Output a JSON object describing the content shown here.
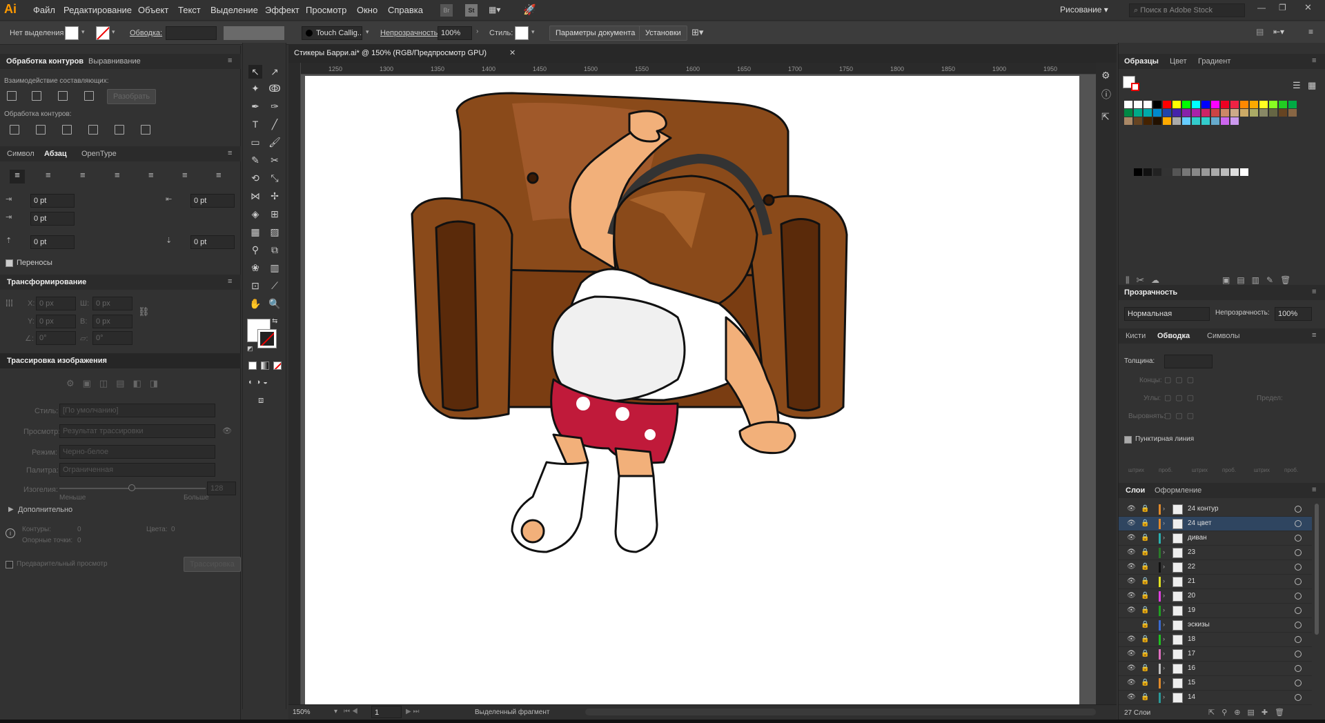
{
  "app": {
    "logo": "Ai"
  },
  "menubar": {
    "items": [
      "Файл",
      "Редактирование",
      "Объект",
      "Текст",
      "Выделение",
      "Эффект",
      "Просмотр",
      "Окно",
      "Справка"
    ],
    "workspace": "Рисование",
    "search_placeholder": "Поиск в Adobe Stock"
  },
  "control": {
    "selection": "Нет выделения",
    "stroke_label": "Обводка:",
    "brush": "Touch Callig...",
    "opacity_label": "Непрозрачность:",
    "opacity_value": "100%",
    "style_label": "Стиль:",
    "doc_setup": "Параметры документа",
    "prefs": "Установки"
  },
  "left": {
    "pathfinder_tabs": [
      "Обработка контуров",
      "Выравнивание"
    ],
    "shape_modes": "Взаимодействие составляющих:",
    "expand": "Разобрать",
    "pathfinders": "Обработка контуров:",
    "type_tabs": [
      "Символ",
      "Абзац",
      "OpenType"
    ],
    "indent_values": [
      "0 pt",
      "0 pt",
      "0 pt",
      "0 pt",
      "0 pt"
    ],
    "hyphenate": "Переносы",
    "transform_title": "Трансформирование",
    "transform": {
      "x_label": "X:",
      "x": "0 px",
      "w_label": "Ш:",
      "w": "0 px",
      "y_label": "Y:",
      "y": "0 px",
      "h_label": "В:",
      "h": "0 px",
      "angle": "0°",
      "shear": "0°"
    },
    "trace_title": "Трассировка изображения",
    "trace": {
      "style_label": "Стиль:",
      "style": "[По умолчанию]",
      "view_label": "Просмотр:",
      "view": "Результат трассировки",
      "mode_label": "Режим:",
      "mode": "Черно-белое",
      "palette_label": "Палитра:",
      "palette": "Ограниченная",
      "threshold_label": "Изогелия:",
      "threshold": "128",
      "less": "Меньше",
      "more": "Больше",
      "advanced": "Дополнительно",
      "paths_label": "Контуры:",
      "paths": "0",
      "colors_label": "Цвета:",
      "colors": "0",
      "anchors_label": "Опорные точки:",
      "anchors": "0",
      "preview": "Предварительный просмотр",
      "trace_btn": "Трассировка"
    }
  },
  "doc": {
    "tab": "Стикеры Барри.ai* @ 150% (RGB/Предпросмотр GPU)",
    "ruler": [
      "1250",
      "1300",
      "1350",
      "1400",
      "1450",
      "1500",
      "1550",
      "1600",
      "1650",
      "1700",
      "1750",
      "1800",
      "1850",
      "1900",
      "1950"
    ]
  },
  "status": {
    "zoom": "150%",
    "page": "1",
    "info": "Выделенный фрагмент"
  },
  "right": {
    "swatch_tabs": [
      "Образцы",
      "Цвет",
      "Градиент"
    ],
    "transparency_title": "Прозрачность",
    "blend": "Нормальная",
    "opacity_label": "Непрозрачность:",
    "opacity": "100%",
    "stroke_tabs": [
      "Кисти",
      "Обводка",
      "Символы"
    ],
    "weight_label": "Толщина:",
    "caps": "Концы:",
    "corners": "Углы:",
    "limit": "Предел:",
    "align": "Выровнять:",
    "dashed": "Пунктирная линия",
    "dash_labels": [
      "штрих",
      "проб.",
      "штрих",
      "проб.",
      "штрих",
      "проб."
    ],
    "layers_tabs": [
      "Слои",
      "Оформление"
    ],
    "layers": [
      {
        "name": "24 контур",
        "color": "#e08a2a",
        "sel": false,
        "eye": true
      },
      {
        "name": "24 цвет",
        "color": "#e08a2a",
        "sel": true,
        "eye": true
      },
      {
        "name": "диван",
        "color": "#2ab0b0",
        "sel": false,
        "eye": true
      },
      {
        "name": "23",
        "color": "#2a7a2a",
        "sel": false,
        "eye": true
      },
      {
        "name": "22",
        "color": "#111111",
        "sel": false,
        "eye": true
      },
      {
        "name": "21",
        "color": "#e0e020",
        "sel": false,
        "eye": true
      },
      {
        "name": "20",
        "color": "#e040e0",
        "sel": false,
        "eye": true
      },
      {
        "name": "19",
        "color": "#20a020",
        "sel": false,
        "eye": true
      },
      {
        "name": "эскизы",
        "color": "#3a6ad0",
        "sel": false,
        "eye": false
      },
      {
        "name": "18",
        "color": "#20c020",
        "sel": false,
        "eye": true
      },
      {
        "name": "17",
        "color": "#e070c0",
        "sel": false,
        "eye": true
      },
      {
        "name": "16",
        "color": "#c0c0c0",
        "sel": false,
        "eye": true
      },
      {
        "name": "15",
        "color": "#e08a2a",
        "sel": false,
        "eye": true
      },
      {
        "name": "14",
        "color": "#2a9a9a",
        "sel": false,
        "eye": true
      }
    ],
    "layers_count": "27 Слои"
  }
}
